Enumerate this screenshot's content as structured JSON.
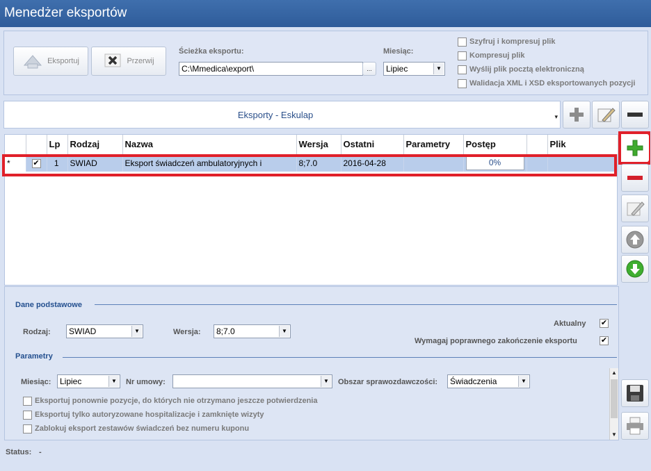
{
  "window": {
    "title": "Menedżer eksportów"
  },
  "toolbar": {
    "export_label": "Eksportuj",
    "stop_label": "Przerwij",
    "path_label": "Ścieżka eksportu:",
    "path_value": "C:\\Mmedica\\export\\",
    "browse_label": "...",
    "month_label": "Miesiąc:",
    "month_value": "Lipiec",
    "options": [
      {
        "label": "Szyfruj i kompresuj plik",
        "checked": false
      },
      {
        "label": "Kompresuj plik",
        "checked": false
      },
      {
        "label": "Wyślij plik pocztą elektroniczną",
        "checked": false
      },
      {
        "label": "Walidacja XML i XSD eksportowanych pozycji",
        "checked": false
      }
    ]
  },
  "profile": {
    "value": "Eksporty - Eskulap"
  },
  "table": {
    "columns": [
      "",
      "",
      "Lp",
      "Rodzaj",
      "Nazwa",
      "Wersja",
      "Ostatni",
      "Parametry",
      "Postęp",
      "",
      "Plik"
    ],
    "rows": [
      {
        "marker": "*",
        "checked": true,
        "lp": "1",
        "rodzaj": "SWIAD",
        "nazwa": "Eksport świadczeń ambulatoryjnych i",
        "wersja": "8;7.0",
        "ostatni": "2016-04-28",
        "parametry": "",
        "postep": "0%",
        "plik": ""
      }
    ]
  },
  "basic": {
    "title": "Dane podstawowe",
    "rodzaj_label": "Rodzaj:",
    "rodzaj_value": "SWIAD",
    "wersja_label": "Wersja:",
    "wersja_value": "8;7.0",
    "aktualny_label": "Aktualny",
    "aktualny_checked": true,
    "wymagaj_label": "Wymagaj poprawnego zakończenie eksportu",
    "wymagaj_checked": true
  },
  "params": {
    "title": "Parametry",
    "miesiac_label": "Miesiąc:",
    "miesiac_value": "Lipiec",
    "umowa_label": "Nr umowy:",
    "umowa_value": "",
    "obszar_label": "Obszar sprawozdawczości:",
    "obszar_value": "Świadczenia",
    "options": [
      {
        "label": "Eksportuj ponownie pozycje, do których nie otrzymano jeszcze potwierdzenia",
        "checked": false
      },
      {
        "label": "Eksportuj tylko autoryzowane hospitalizacje i zamknięte wizyty",
        "checked": false
      },
      {
        "label": "Zablokuj eksport zestawów świadczeń bez numeru kuponu",
        "checked": false
      }
    ]
  },
  "status": {
    "label": "Status:",
    "value": "-"
  },
  "colors": {
    "highlight": "#e0202a",
    "title_bar": "#2f5c9a",
    "selected_row": "#b9cdeb"
  }
}
